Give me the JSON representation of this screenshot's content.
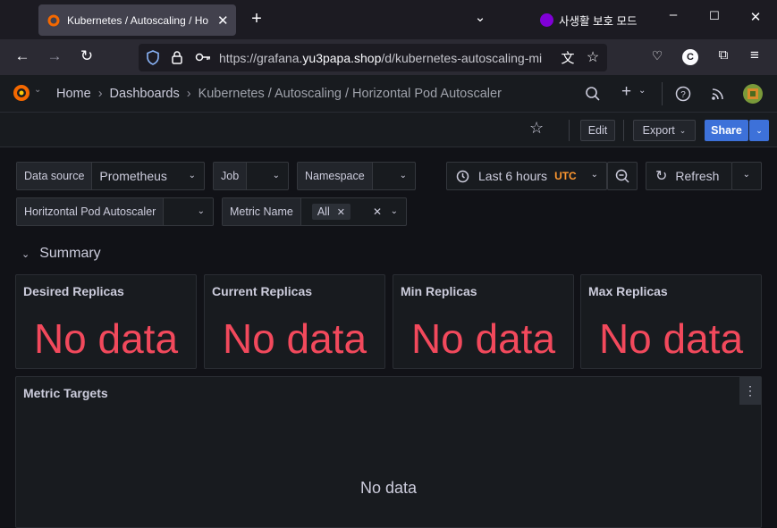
{
  "browser": {
    "tab_title": "Kubernetes / Autoscaling / Ho",
    "private_mode_label": "사생활 보호 모드",
    "url_prefix": "https://grafana.",
    "url_host": "yu3papa.shop",
    "url_path": "/d/kubernetes-autoscaling-mi",
    "profile_initial": "C"
  },
  "breadcrumb": {
    "home": "Home",
    "dashboards": "Dashboards",
    "current": "Kubernetes / Autoscaling / Horizontal Pod Autoscaler"
  },
  "toolbar": {
    "edit_label": "Edit",
    "export_label": "Export",
    "share_label": "Share"
  },
  "variables": {
    "datasource_label": "Data source",
    "datasource_value": "Prometheus",
    "job_label": "Job",
    "namespace_label": "Namespace",
    "hpa_label": "Horitzontal Pod Autoscaler",
    "metric_label": "Metric Name",
    "metric_value": "All"
  },
  "timepicker": {
    "range": "Last 6 hours",
    "tz": "UTC",
    "refresh_label": "Refresh"
  },
  "row": {
    "title": "Summary"
  },
  "panels": [
    {
      "title": "Desired Replicas",
      "value": "No data"
    },
    {
      "title": "Current Replicas",
      "value": "No data"
    },
    {
      "title": "Min Replicas",
      "value": "No data"
    },
    {
      "title": "Max Replicas",
      "value": "No data"
    }
  ],
  "metric_targets": {
    "title": "Metric Targets",
    "value": "No data"
  },
  "colors": {
    "nodata": "#f2495c",
    "accent": "#3d71d9",
    "utc": "#ff9830"
  }
}
